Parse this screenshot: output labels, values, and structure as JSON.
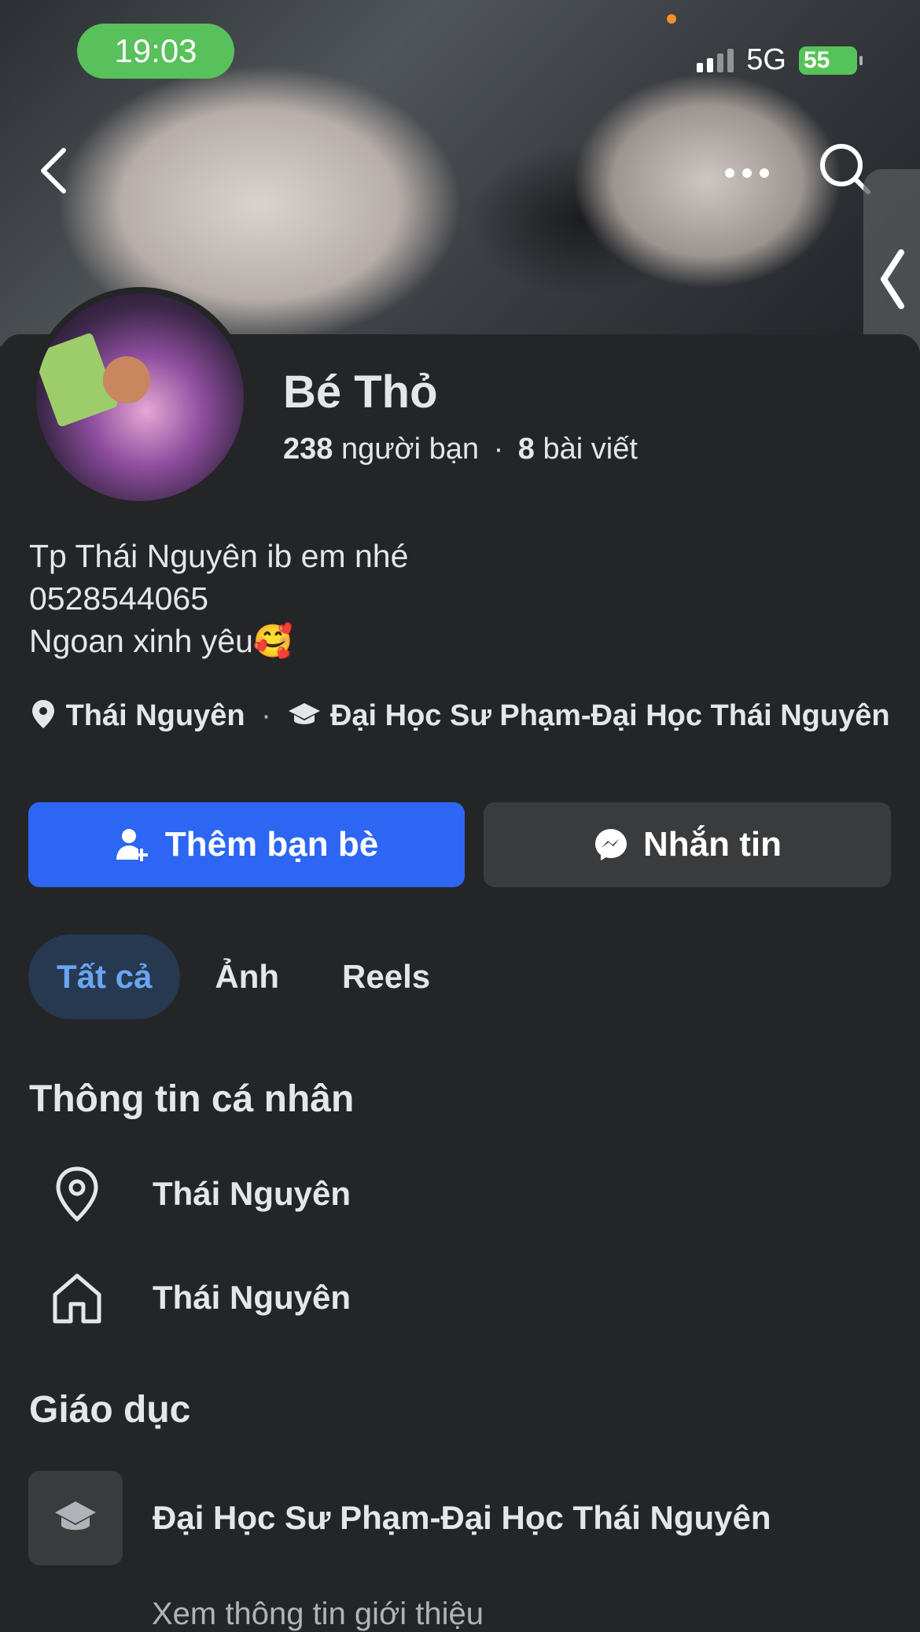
{
  "status_bar": {
    "time": "19:03",
    "network": "5G",
    "battery": "55"
  },
  "icons": {
    "back": "chevron-left-icon",
    "more": "more-horizontal-icon",
    "search": "search-icon",
    "side_handle": "chevron-left-icon",
    "location": "location-pin-icon",
    "school": "graduation-cap-icon",
    "add_friend": "add-friend-icon",
    "messenger": "messenger-icon",
    "home": "home-icon"
  },
  "profile": {
    "name": "Bé Thỏ",
    "friends_count": "238",
    "friends_label": "người bạn",
    "stat_separator": "·",
    "posts_count": "8",
    "posts_label": "bài viết",
    "bio_lines": [
      "Tp Thái Nguyên ib em nhé",
      "0528544065",
      "Ngoan xinh yêu🥰"
    ],
    "location": "Thái Nguyên",
    "meta_separator": "·",
    "school": "Đại Học Sư Phạm-Đại Học Thái Nguyên"
  },
  "actions": {
    "add_friend": "Thêm bạn bè",
    "message": "Nhắn tin"
  },
  "tabs": [
    {
      "label": "Tất cả",
      "active": true
    },
    {
      "label": "Ảnh",
      "active": false
    },
    {
      "label": "Reels",
      "active": false
    }
  ],
  "personal_info": {
    "title": "Thông tin cá nhân",
    "items": [
      {
        "icon": "location-pin-icon",
        "text": "Thái Nguyên"
      },
      {
        "icon": "home-icon",
        "text": "Thái Nguyên"
      }
    ]
  },
  "education": {
    "title": "Giáo dục",
    "school": "Đại Học Sư Phạm-Đại Học Thái Nguyên",
    "more_link": "Xem thông tin giới thiệu"
  },
  "colors": {
    "accent": "#2d66f3",
    "background": "#242526",
    "active_tab_bg": "#263950",
    "active_tab_text": "#6aa5f5",
    "status_green": "#58c15b"
  }
}
